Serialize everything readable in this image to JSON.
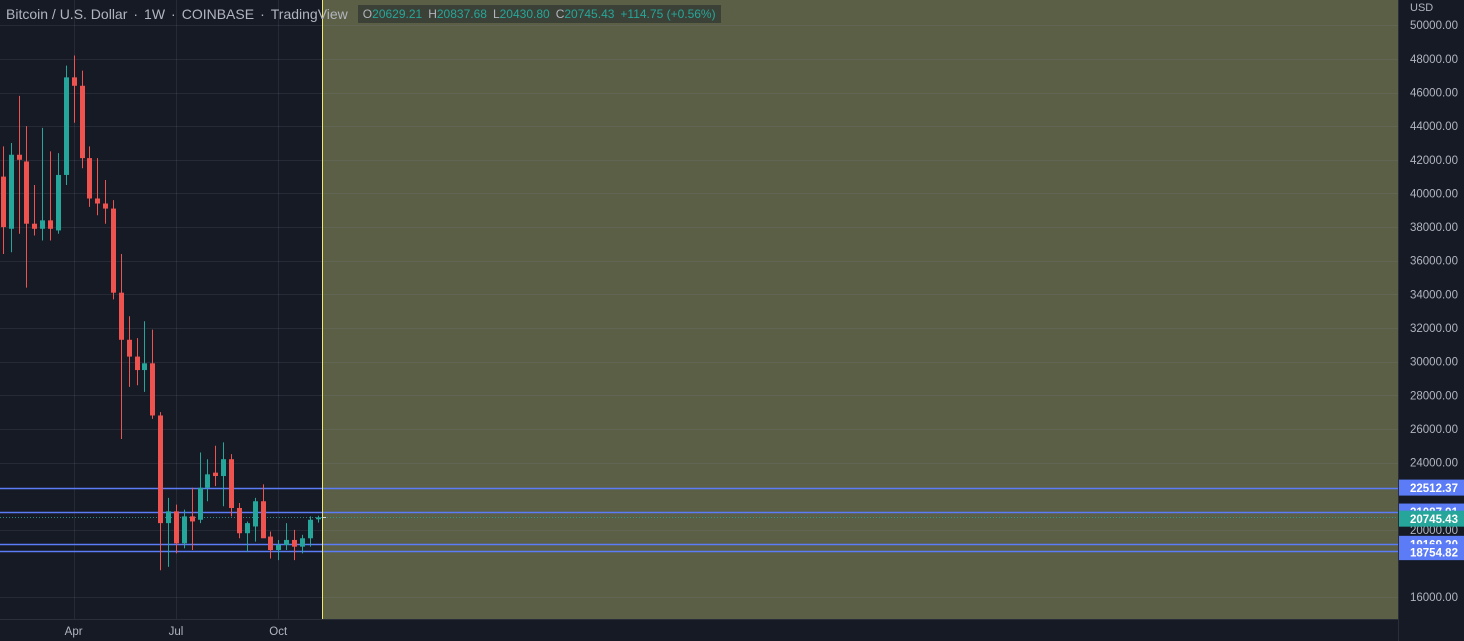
{
  "header": {
    "symbol": "Bitcoin / U.S. Dollar",
    "interval": "1W",
    "exchange": "COINBASE",
    "source": "TradingView",
    "ohlc": {
      "o_label": "O",
      "o_value": "20629.21",
      "h_label": "H",
      "h_value": "20837.68",
      "l_label": "L",
      "l_value": "20430.80",
      "c_label": "C",
      "c_value": "20745.43",
      "change": "+114.75 (+0.56%)"
    }
  },
  "colors": {
    "background": "#161a25",
    "grid": "#222632",
    "up": "#26a69a",
    "down": "#ef5350",
    "zone": "#5a5f46",
    "hline": "#5b7cf6",
    "cursor": "#f0e86b",
    "axis_text": "#b2b5be"
  },
  "chart_data": {
    "type": "candlestick",
    "unit": "USD",
    "ylim": [
      14700,
      51500
    ],
    "y_ticks": [
      "50000.00",
      "48000.00",
      "46000.00",
      "44000.00",
      "42000.00",
      "40000.00",
      "38000.00",
      "36000.00",
      "34000.00",
      "32000.00",
      "30000.00",
      "28000.00",
      "26000.00",
      "24000.00",
      "20000.00",
      "16000.00"
    ],
    "x_ticks": [
      {
        "label": "Apr",
        "index": 9
      },
      {
        "label": "Jul",
        "index": 22
      },
      {
        "label": "Oct",
        "index": 35
      }
    ],
    "candles": [
      {
        "o": 41000,
        "h": 42800,
        "l": 36400,
        "c": 38000
      },
      {
        "o": 37900,
        "h": 43000,
        "l": 36500,
        "c": 42300
      },
      {
        "o": 42300,
        "h": 45800,
        "l": 37600,
        "c": 42000
      },
      {
        "o": 41900,
        "h": 44000,
        "l": 34400,
        "c": 38200
      },
      {
        "o": 38200,
        "h": 40500,
        "l": 37500,
        "c": 37900
      },
      {
        "o": 37900,
        "h": 43900,
        "l": 37200,
        "c": 38400
      },
      {
        "o": 38400,
        "h": 42500,
        "l": 37200,
        "c": 37900
      },
      {
        "o": 37800,
        "h": 42400,
        "l": 37600,
        "c": 41100
      },
      {
        "o": 41100,
        "h": 47600,
        "l": 40500,
        "c": 46900
      },
      {
        "o": 46900,
        "h": 48200,
        "l": 44200,
        "c": 46400
      },
      {
        "o": 46400,
        "h": 47300,
        "l": 41500,
        "c": 42100
      },
      {
        "o": 42100,
        "h": 42800,
        "l": 39200,
        "c": 39700
      },
      {
        "o": 39700,
        "h": 42100,
        "l": 38700,
        "c": 39400
      },
      {
        "o": 39400,
        "h": 40800,
        "l": 38200,
        "c": 39100
      },
      {
        "o": 39100,
        "h": 39600,
        "l": 33700,
        "c": 34100
      },
      {
        "o": 34100,
        "h": 36400,
        "l": 25400,
        "c": 31300
      },
      {
        "o": 31300,
        "h": 32700,
        "l": 28500,
        "c": 30300
      },
      {
        "o": 30300,
        "h": 31400,
        "l": 28600,
        "c": 29500
      },
      {
        "o": 29500,
        "h": 32400,
        "l": 28200,
        "c": 29900
      },
      {
        "o": 29900,
        "h": 31900,
        "l": 26600,
        "c": 26800
      },
      {
        "o": 26800,
        "h": 27000,
        "l": 17600,
        "c": 20400
      },
      {
        "o": 20400,
        "h": 21900,
        "l": 17800,
        "c": 21100
      },
      {
        "o": 21100,
        "h": 21500,
        "l": 18600,
        "c": 19200
      },
      {
        "o": 19200,
        "h": 21200,
        "l": 18900,
        "c": 20800
      },
      {
        "o": 20800,
        "h": 22500,
        "l": 18800,
        "c": 20500
      },
      {
        "o": 20600,
        "h": 24600,
        "l": 20400,
        "c": 22500
      },
      {
        "o": 22500,
        "h": 24200,
        "l": 21700,
        "c": 23300
      },
      {
        "o": 23400,
        "h": 25000,
        "l": 22600,
        "c": 23200
      },
      {
        "o": 23200,
        "h": 25200,
        "l": 21400,
        "c": 24200
      },
      {
        "o": 24200,
        "h": 24500,
        "l": 20800,
        "c": 21300
      },
      {
        "o": 21300,
        "h": 21600,
        "l": 19500,
        "c": 19800
      },
      {
        "o": 19800,
        "h": 20500,
        "l": 18700,
        "c": 20400
      },
      {
        "o": 20200,
        "h": 21900,
        "l": 19300,
        "c": 21700
      },
      {
        "o": 21700,
        "h": 22700,
        "l": 19700,
        "c": 19500
      },
      {
        "o": 19600,
        "h": 19900,
        "l": 18300,
        "c": 18800
      },
      {
        "o": 18800,
        "h": 19400,
        "l": 18200,
        "c": 19100
      },
      {
        "o": 19100,
        "h": 20400,
        "l": 18800,
        "c": 19400
      },
      {
        "o": 19400,
        "h": 20000,
        "l": 18200,
        "c": 19000
      },
      {
        "o": 19000,
        "h": 19700,
        "l": 18600,
        "c": 19500
      },
      {
        "o": 19500,
        "h": 20800,
        "l": 19000,
        "c": 20600
      },
      {
        "o": 20629.21,
        "h": 20837.68,
        "l": 20430.8,
        "c": 20745.43
      }
    ],
    "price_lines": [
      {
        "value": 22512.37,
        "label": "22512.37"
      },
      {
        "value": 21087.91,
        "label": "21087.91"
      },
      {
        "value": 19169.2,
        "label": "19169.20"
      },
      {
        "value": 18754.82,
        "label": "18754.82"
      }
    ],
    "last_price": {
      "value": 20745.43,
      "label": "20745.43"
    },
    "highlight_zone": "future area right of last bar"
  }
}
